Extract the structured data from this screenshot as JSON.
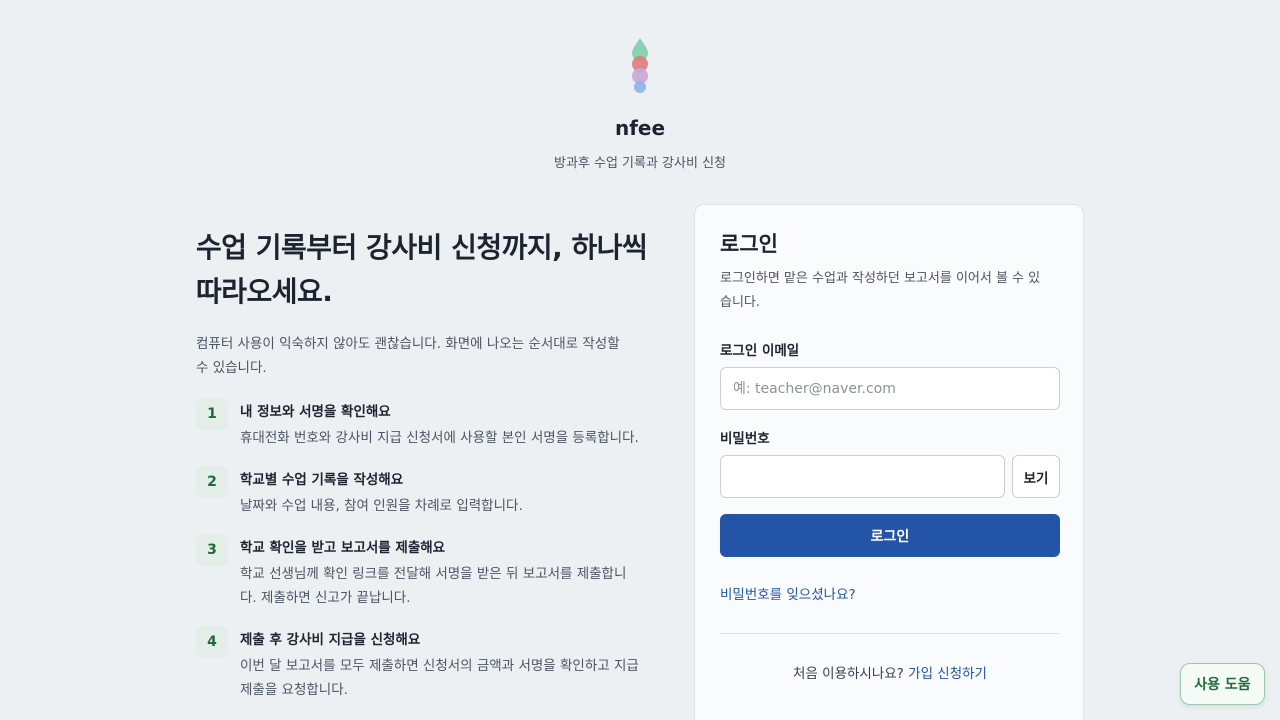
{
  "brand": {
    "name": "nfee",
    "tagline": "방과후 수업 기록과 강사비 신청",
    "logo_colors": [
      "#7fcfa8",
      "#e07b7b",
      "#c4a7d4",
      "#8fb0e8"
    ]
  },
  "intro": {
    "headline_line1": "수업 기록부터 강사비 신청까지, 하나씩",
    "headline_line2": "따라오세요.",
    "description": "컴퓨터 사용이 익숙하지 않아도 괜찮습니다. 화면에 나오는 순서대로 작성할 수 있습니다.",
    "steps": [
      {
        "num": "1",
        "title": "내 정보와 서명을 확인해요",
        "desc": "휴대전화 번호와 강사비 지급 신청서에 사용할 본인 서명을 등록합니다."
      },
      {
        "num": "2",
        "title": "학교별 수업 기록을 작성해요",
        "desc": "날짜와 수업 내용, 참여 인원을 차례로 입력합니다."
      },
      {
        "num": "3",
        "title": "학교 확인을 받고 보고서를 제출해요",
        "desc": "학교 선생님께 확인 링크를 전달해 서명을 받은 뒤 보고서를 제출합니다. 제출하면 신고가 끝납니다."
      },
      {
        "num": "4",
        "title": "제출 후 강사비 지급을 신청해요",
        "desc": "이번 달 보고서를 모두 제출하면 신청서의 금액과 서명을 확인하고 지급 제출을 요청합니다."
      }
    ]
  },
  "login": {
    "title": "로그인",
    "description": "로그인하면 맡은 수업과 작성하던 보고서를 이어서 볼 수 있습니다.",
    "email_label": "로그인 이메일",
    "email_placeholder": "예: teacher@naver.com",
    "email_value": "",
    "password_label": "비밀번호",
    "password_value": "",
    "show_password_label": "보기",
    "submit_label": "로그인",
    "forgot_label": "비밀번호를 잊으셨나요?",
    "signup_prompt": "처음 이용하시나요?",
    "signup_link": "가입 신청하기"
  },
  "help": {
    "label": "사용 도움"
  },
  "colors": {
    "primary": "#2454a6",
    "accent_green": "#1e6b3a",
    "background": "#edf0f3"
  }
}
